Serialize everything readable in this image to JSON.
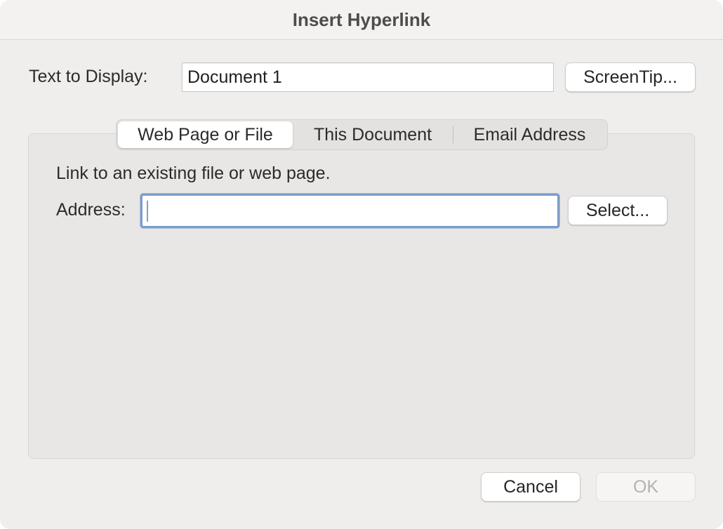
{
  "window": {
    "title": "Insert Hyperlink"
  },
  "display": {
    "label": "Text to Display:",
    "value": "Document 1",
    "screentip_label": "ScreenTip..."
  },
  "tabs": [
    {
      "label": "Web Page or File",
      "active": true
    },
    {
      "label": "This Document",
      "active": false
    },
    {
      "label": "Email Address",
      "active": false
    }
  ],
  "web_page": {
    "description": "Link to an existing file or web page.",
    "address_label": "Address:",
    "address_value": "",
    "select_label": "Select..."
  },
  "footer": {
    "cancel_label": "Cancel",
    "ok_label": "OK",
    "ok_enabled": false
  },
  "colors": {
    "focus_ring": "#7d9cc9",
    "dialog_bg": "#efeeed",
    "panel_bg": "#e8e7e6"
  }
}
